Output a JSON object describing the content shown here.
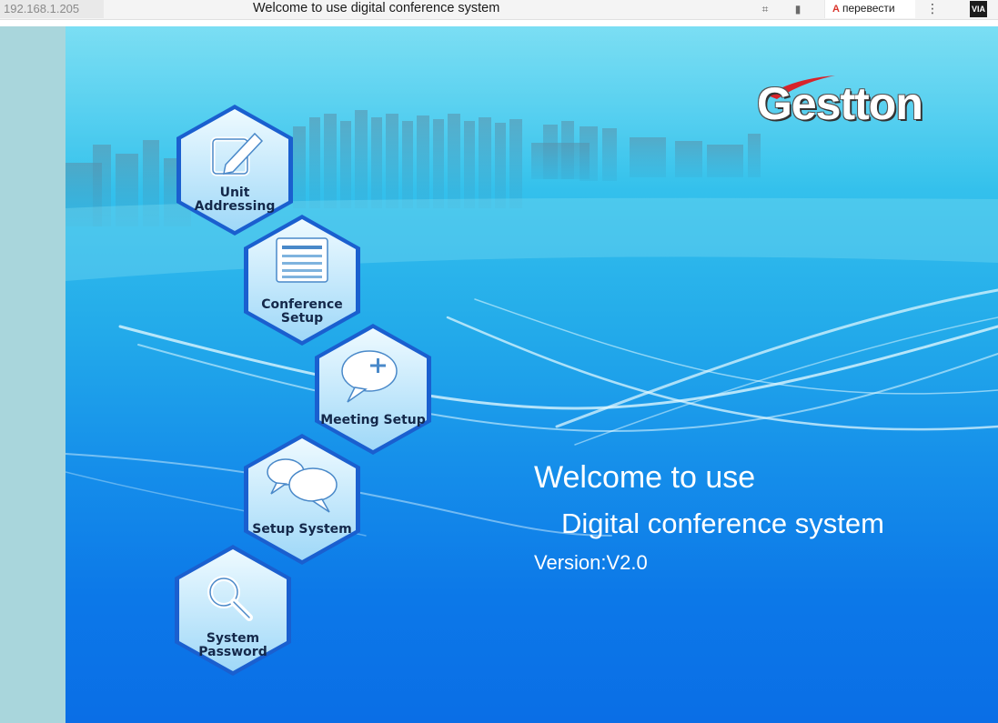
{
  "browser": {
    "url": "192.168.1.205",
    "title": "Welcome to use digital conference system",
    "translate_label": "перевести",
    "translate_glyph": "A",
    "menu_glyph": "⋮",
    "extension_label": "VIA"
  },
  "brand": {
    "logo_text": "Gestton",
    "logo_accent_color": "#d8232a"
  },
  "menu": {
    "unit_addressing": {
      "line1": "Unit",
      "line2": "Addressing",
      "icon": "edit-icon"
    },
    "conference_setup": {
      "line1": "Conference",
      "line2": "Setup",
      "icon": "list-icon"
    },
    "meeting_setup": {
      "line1": "Meeting Setup",
      "icon": "chat-add-icon"
    },
    "setup_system": {
      "line1": "Setup System",
      "icon": "chat-bubbles-icon"
    },
    "system_password": {
      "line1": "System",
      "line2": "Password",
      "icon": "magnifier-icon"
    }
  },
  "welcome": {
    "line1": "Welcome to use",
    "line2": "Digital conference system",
    "version": "Version:V2.0"
  },
  "colors": {
    "bg_top": "#4fd3f0",
    "bg_bottom": "#0a6ee6",
    "hex_fill": "#cbeeff",
    "hex_border": "#1a5fcf",
    "left_strip": "#a9d6dc"
  }
}
